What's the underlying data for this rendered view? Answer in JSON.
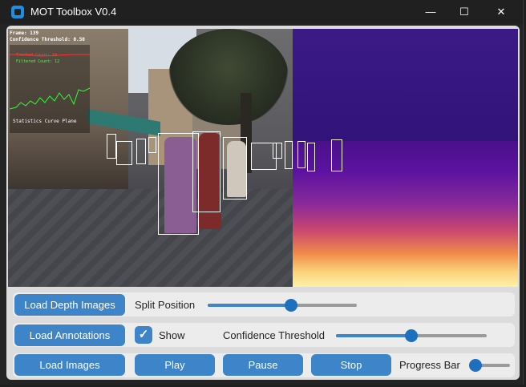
{
  "window": {
    "title": "MOT Toolbox V0.4",
    "controls": {
      "minimize": "—",
      "maximize": "☐",
      "close": "✕"
    }
  },
  "viewer": {
    "frame_text": "Frame: 139",
    "confidence_text": "Confidence Threshold: 0.50",
    "mini_chart_red": "Tracked Count: 18",
    "mini_chart_green": "Filtered Count: 12",
    "caption": "Statistics Curve Plane"
  },
  "controls": {
    "row1": {
      "load_depth_label": "Load Depth Images",
      "split_label": "Split Position",
      "split_value": 0.56
    },
    "row2": {
      "load_annotations_label": "Load Annotations",
      "show_label": "Show",
      "show_checked": true,
      "confidence_label": "Confidence Threshold",
      "confidence_value": 0.5
    },
    "row3": {
      "load_images_label": "Load Images",
      "play_label": "Play",
      "pause_label": "Pause",
      "stop_label": "Stop",
      "progress_label": "Progress Bar",
      "progress_value": 0.1
    }
  },
  "colors": {
    "accent": "#3d84c9",
    "knob": "#1f6fbf",
    "panel": "#dcdcdc",
    "titlebar": "#202020"
  }
}
